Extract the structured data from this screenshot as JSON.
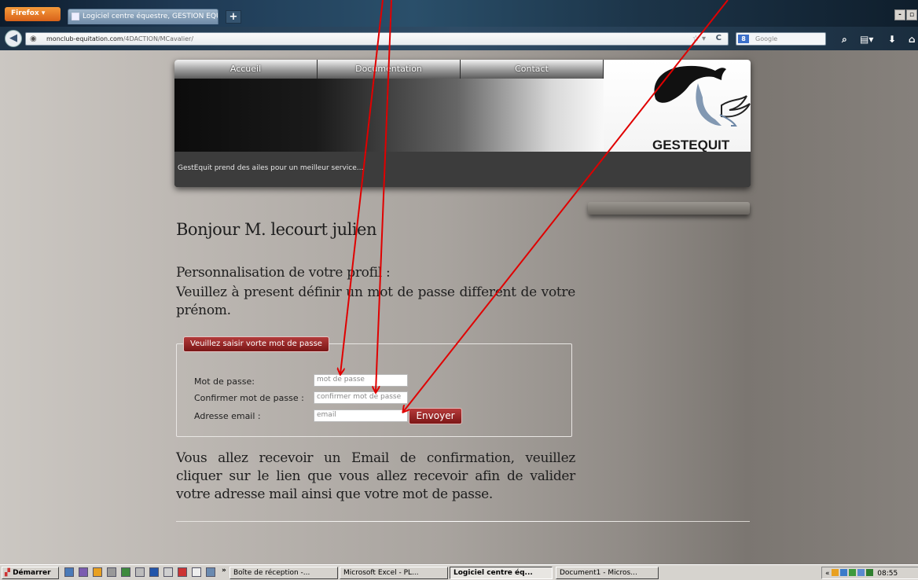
{
  "browser": {
    "menu_button": "Firefox",
    "tab_title": "Logiciel centre équestre, GESTION EQUITAT",
    "new_tab": "+",
    "url_host": "monclub-equitation.com",
    "url_path": "/4DACTION/MCavalier/",
    "search_placeholder": "Google",
    "window_minimize": "-",
    "window_restore": "▫"
  },
  "site": {
    "menu": [
      "Accueil",
      "Documentation",
      "Contact"
    ],
    "logo_text": "GESTEQUIT",
    "tagline": "GestEquit prend des ailes pour un meilleur service..."
  },
  "main": {
    "greeting": "Bonjour M. lecourt julien",
    "subtitle": "Personnalisation de votre profil :",
    "instruction": "Veuillez à present définir un mot de passe different de votre prénom.",
    "form": {
      "legend": "Veuillez saisir vorte mot de passe",
      "password_label": "Mot de passe:",
      "password_placeholder": "mot de passe",
      "confirm_label": "Confirmer mot de passe :",
      "confirm_placeholder": "confirmer mot de passe",
      "email_label": "Adresse email :",
      "email_placeholder": "email",
      "submit": "Envoyer"
    },
    "confirmation": "Vous allez recevoir un Email de confirmation, veuillez cliquer sur le lien que vous allez recevoir afin de valider votre adresse mail ainsi que votre mot de passe."
  },
  "taskbar": {
    "start": "Démarrer",
    "more": "»",
    "items": [
      "Boîte de réception -...",
      "Microsoft Excel - PL...",
      "Logiciel centre éq...",
      "Document1 - Micros..."
    ],
    "tray_chevron": "«",
    "clock": "08:55"
  },
  "colors": {
    "accent_red": "#9b2222",
    "annotation_arrow": "#e00000",
    "header_dark": "#3c3c3c"
  }
}
